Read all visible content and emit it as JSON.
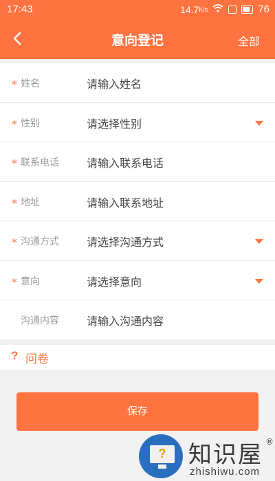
{
  "status_bar": {
    "time": "17:43",
    "speed_value": "14.7",
    "speed_unit": "K/s",
    "battery": "76"
  },
  "header": {
    "title": "意向登记",
    "right_action": "全部",
    "back_icon": "back-arrow-icon"
  },
  "form": {
    "fields": [
      {
        "required": "*",
        "label": "姓名",
        "placeholder": "请输入姓名",
        "type": "input"
      },
      {
        "required": "*",
        "label": "性别",
        "placeholder": "请选择性别",
        "type": "select"
      },
      {
        "required": "*",
        "label": "联系电话",
        "placeholder": "请输入联系电话",
        "type": "input"
      },
      {
        "required": "*",
        "label": "地址",
        "placeholder": "请输入联系地址",
        "type": "input"
      },
      {
        "required": "*",
        "label": "沟通方式",
        "placeholder": "请选择沟通方式",
        "type": "select"
      },
      {
        "required": "*",
        "label": "意向",
        "placeholder": "请选择意向",
        "type": "select"
      },
      {
        "required": "",
        "label": "沟通内容",
        "placeholder": "请输入沟通内容",
        "type": "input"
      }
    ]
  },
  "questionnaire": {
    "icon": "?",
    "label": "问卷"
  },
  "actions": {
    "save_label": "保存"
  },
  "watermark": {
    "brand": "知识屋",
    "domain": "zhishiwu.com",
    "registered": "®",
    "icon_mark": "?"
  },
  "colors": {
    "accent": "#ff7340",
    "background": "#f2f2f2"
  }
}
